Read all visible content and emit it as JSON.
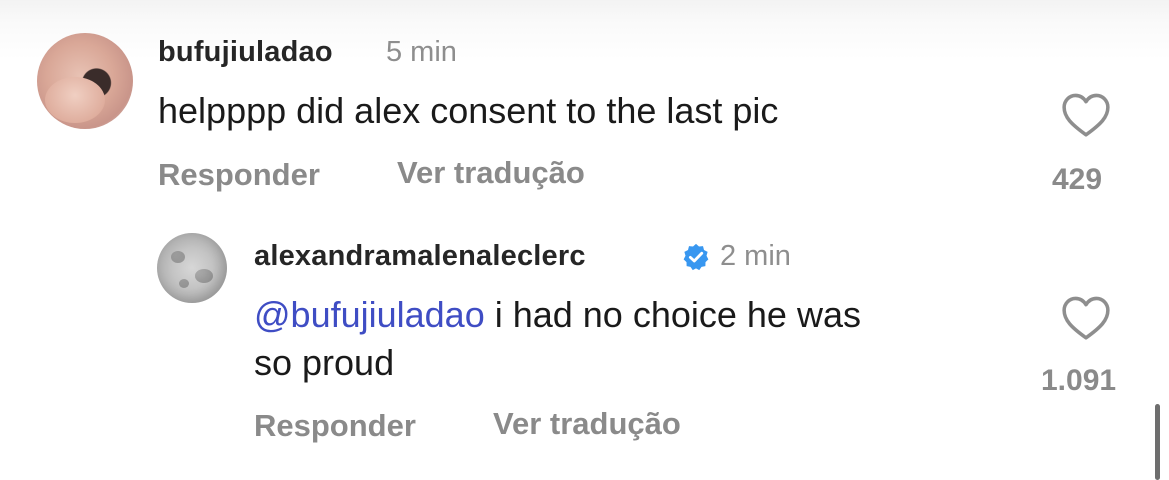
{
  "comments": [
    {
      "username": "bufujiuladao",
      "time": "5 min",
      "text": "helpppp did alex consent to the last pic",
      "reply_label": "Responder",
      "translate_label": "Ver tradução",
      "likes": "429",
      "icons": {
        "like": "heart-outline-icon"
      }
    },
    {
      "username": "alexandramalenaleclerc",
      "verified": true,
      "time": "2 min",
      "mention": "@bufujiuladao",
      "text_line1": " i had no choice he was",
      "text_line2": "so proud",
      "reply_label": "Responder",
      "translate_label": "Ver tradução",
      "likes": "1.091",
      "icons": {
        "like": "heart-outline-icon",
        "badge": "verified-badge-icon"
      }
    }
  ],
  "colors": {
    "mention": "#3f4dc4",
    "verified": "#3897f0",
    "secondary_text": "#8a8a8a"
  }
}
